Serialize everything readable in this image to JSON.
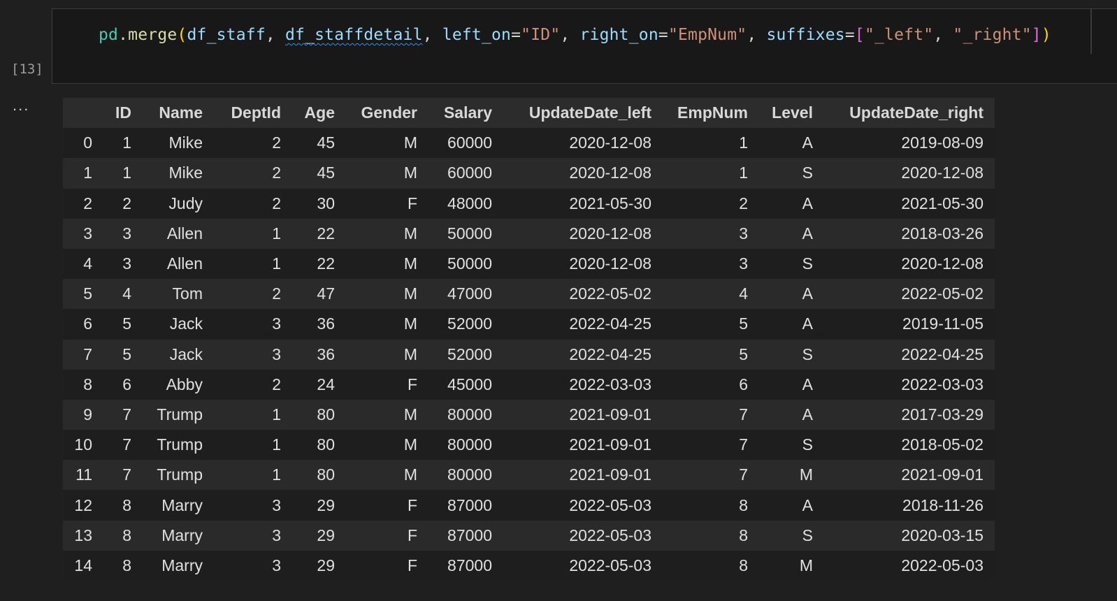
{
  "cell": {
    "execution_count": "[13]",
    "output_menu": "...",
    "code_tokens": [
      {
        "text": "pd",
        "cls": "tok-var"
      },
      {
        "text": ".",
        "cls": "tok-punc"
      },
      {
        "text": "merge",
        "cls": "tok-fn"
      },
      {
        "text": "(",
        "cls": "tok-paren"
      },
      {
        "text": "df_staff",
        "cls": "tok-id"
      },
      {
        "text": ", ",
        "cls": "tok-punc"
      },
      {
        "text": "df_staffdetail",
        "cls": "tok-id squiggle"
      },
      {
        "text": ", ",
        "cls": "tok-punc"
      },
      {
        "text": "left_on",
        "cls": "tok-id"
      },
      {
        "text": "=",
        "cls": "tok-punc"
      },
      {
        "text": "\"ID\"",
        "cls": "tok-str"
      },
      {
        "text": ", ",
        "cls": "tok-punc"
      },
      {
        "text": "right_on",
        "cls": "tok-id"
      },
      {
        "text": "=",
        "cls": "tok-punc"
      },
      {
        "text": "\"EmpNum\"",
        "cls": "tok-str"
      },
      {
        "text": ", ",
        "cls": "tok-punc"
      },
      {
        "text": "suffixes",
        "cls": "tok-id"
      },
      {
        "text": "=",
        "cls": "tok-punc"
      },
      {
        "text": "[",
        "cls": "tok-bracket"
      },
      {
        "text": "\"_left\"",
        "cls": "tok-str"
      },
      {
        "text": ", ",
        "cls": "tok-punc"
      },
      {
        "text": "\"_right\"",
        "cls": "tok-str"
      },
      {
        "text": "]",
        "cls": "tok-bracket"
      },
      {
        "text": ")",
        "cls": "tok-paren"
      }
    ]
  },
  "table": {
    "columns": [
      "",
      "ID",
      "Name",
      "DeptId",
      "Age",
      "Gender",
      "Salary",
      "UpdateDate_left",
      "EmpNum",
      "Level",
      "UpdateDate_right"
    ],
    "rows": [
      [
        "0",
        "1",
        "Mike",
        "2",
        "45",
        "M",
        "60000",
        "2020-12-08",
        "1",
        "A",
        "2019-08-09"
      ],
      [
        "1",
        "1",
        "Mike",
        "2",
        "45",
        "M",
        "60000",
        "2020-12-08",
        "1",
        "S",
        "2020-12-08"
      ],
      [
        "2",
        "2",
        "Judy",
        "2",
        "30",
        "F",
        "48000",
        "2021-05-30",
        "2",
        "A",
        "2021-05-30"
      ],
      [
        "3",
        "3",
        "Allen",
        "1",
        "22",
        "M",
        "50000",
        "2020-12-08",
        "3",
        "A",
        "2018-03-26"
      ],
      [
        "4",
        "3",
        "Allen",
        "1",
        "22",
        "M",
        "50000",
        "2020-12-08",
        "3",
        "S",
        "2020-12-08"
      ],
      [
        "5",
        "4",
        "Tom",
        "2",
        "47",
        "M",
        "47000",
        "2022-05-02",
        "4",
        "A",
        "2022-05-02"
      ],
      [
        "6",
        "5",
        "Jack",
        "3",
        "36",
        "M",
        "52000",
        "2022-04-25",
        "5",
        "A",
        "2019-11-05"
      ],
      [
        "7",
        "5",
        "Jack",
        "3",
        "36",
        "M",
        "52000",
        "2022-04-25",
        "5",
        "S",
        "2022-04-25"
      ],
      [
        "8",
        "6",
        "Abby",
        "2",
        "24",
        "F",
        "45000",
        "2022-03-03",
        "6",
        "A",
        "2022-03-03"
      ],
      [
        "9",
        "7",
        "Trump",
        "1",
        "80",
        "M",
        "80000",
        "2021-09-01",
        "7",
        "A",
        "2017-03-29"
      ],
      [
        "10",
        "7",
        "Trump",
        "1",
        "80",
        "M",
        "80000",
        "2021-09-01",
        "7",
        "S",
        "2018-05-02"
      ],
      [
        "11",
        "7",
        "Trump",
        "1",
        "80",
        "M",
        "80000",
        "2021-09-01",
        "7",
        "M",
        "2021-09-01"
      ],
      [
        "12",
        "8",
        "Marry",
        "3",
        "29",
        "F",
        "87000",
        "2022-05-03",
        "8",
        "A",
        "2018-11-26"
      ],
      [
        "13",
        "8",
        "Marry",
        "3",
        "29",
        "F",
        "87000",
        "2022-05-03",
        "8",
        "S",
        "2020-03-15"
      ],
      [
        "14",
        "8",
        "Marry",
        "3",
        "29",
        "F",
        "87000",
        "2022-05-03",
        "8",
        "M",
        "2022-05-03"
      ]
    ]
  }
}
